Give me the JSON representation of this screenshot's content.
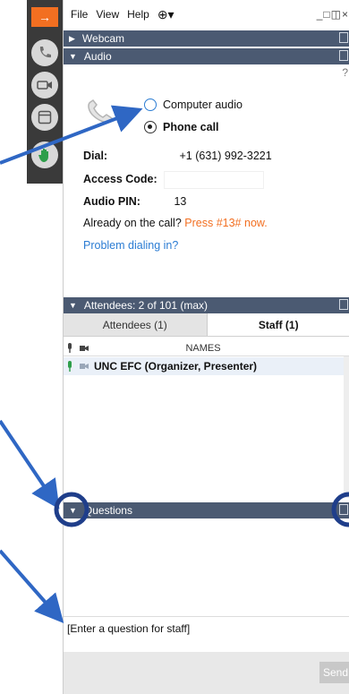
{
  "menu": {
    "file": "File",
    "view": "View",
    "help": "Help"
  },
  "sections": {
    "webcam": "Webcam",
    "audio": "Audio",
    "attendees": "Attendees: 2 of 101 (max)",
    "questions": "Questions"
  },
  "audio": {
    "option_computer": "Computer audio",
    "option_phone": "Phone call",
    "dial_label": "Dial:",
    "dial_value": "+1 (631) 992-3221",
    "access_label": "Access Code:",
    "pin_label": "Audio PIN:",
    "pin_value": "13",
    "already_text": "Already on the call?",
    "press_text": "Press #13# now.",
    "problem_link": "Problem dialing in?"
  },
  "tabs": {
    "attendees": "Attendees (1)",
    "staff": "Staff (1)"
  },
  "list": {
    "names_header": "NAMES",
    "rows": [
      {
        "name": "UNC EFC (Organizer, Presenter)"
      }
    ]
  },
  "questions": {
    "placeholder": "[Enter a question for staff]",
    "send_label": "Send"
  },
  "colors": {
    "accent_orange": "#f26f21",
    "header_bar": "#4b5a72",
    "annotation_blue": "#2f67c4",
    "link_blue": "#2b7cd3"
  }
}
